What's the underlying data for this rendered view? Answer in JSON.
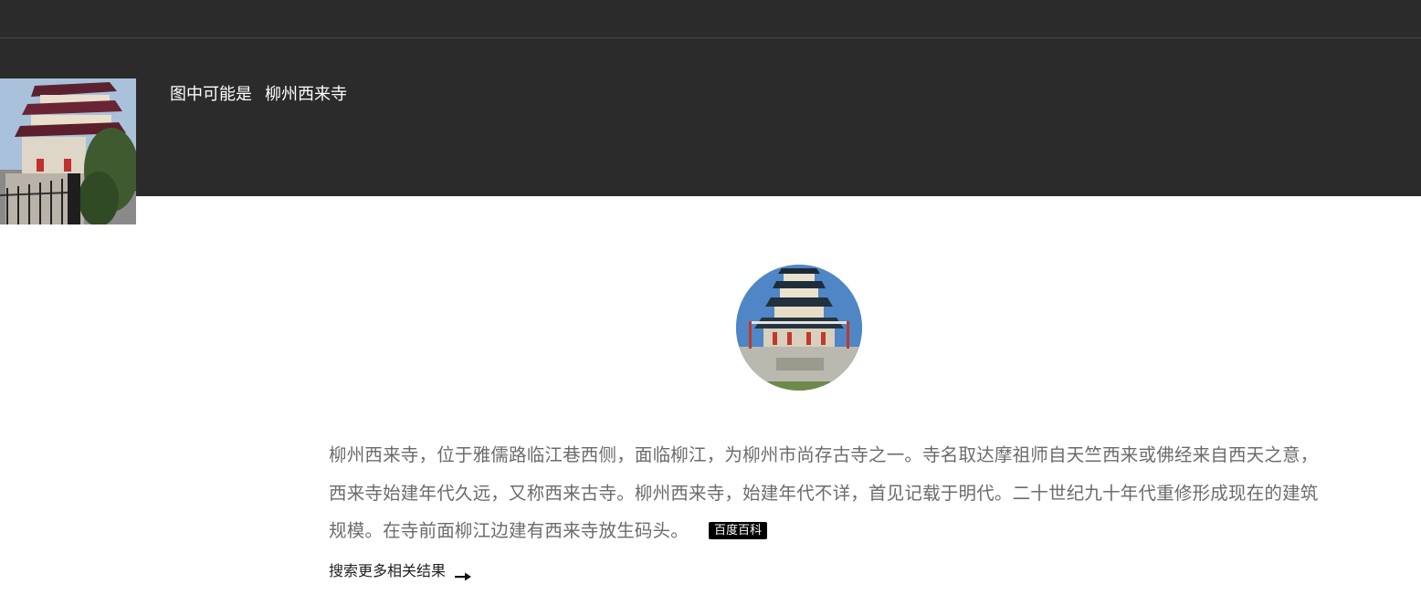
{
  "header": {
    "recognition_prefix": "图中可能是",
    "recognition_result": "柳州西来寺"
  },
  "description": {
    "text": "柳州西来寺，位于雅儒路临江巷西侧，面临柳江，为柳州市尚存古寺之一。寺名取达摩祖师自天竺西来或佛经来自西天之意，西来寺始建年代久远，又称西来古寺。柳州西来寺，始建年代不详，首见记载于明代。二十世纪九十年代重修形成现在的建筑规模。在寺前面柳江边建有西来寺放生码头。",
    "source_badge": "百度百科"
  },
  "more_results": {
    "label": "搜索更多相关结果",
    "icon": "arrow-right-icon"
  },
  "colors": {
    "header_bg": "#2b2b2b",
    "badge_bg": "#000000",
    "desc_text": "#6b6b6b"
  }
}
